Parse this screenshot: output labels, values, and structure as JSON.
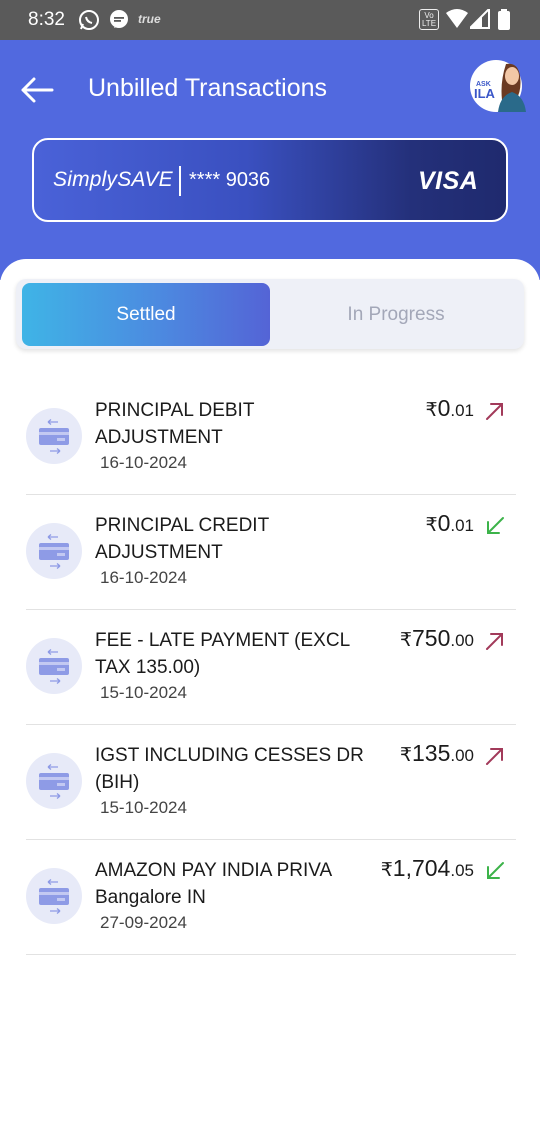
{
  "status_bar": {
    "time": "8:32",
    "carrier_tag": "true",
    "volte_label": "Vo LTE"
  },
  "header": {
    "title": "Unbilled Transactions",
    "assistant_label": "ASK ILA"
  },
  "card": {
    "brand": "SimplySAVE",
    "number": "**** 9036",
    "network": "VISA"
  },
  "tabs": [
    {
      "label": "Settled",
      "active": true
    },
    {
      "label": "In Progress",
      "active": false
    }
  ],
  "currency_symbol": "₹",
  "transactions": [
    {
      "name": "PRINCIPAL DEBIT ADJUSTMENT",
      "date": "16-10-2024",
      "amount_main": "0",
      "amount_dec": ".01",
      "direction": "debit"
    },
    {
      "name": "PRINCIPAL CREDIT ADJUSTMENT",
      "date": "16-10-2024",
      "amount_main": "0",
      "amount_dec": ".01",
      "direction": "credit"
    },
    {
      "name": "FEE - LATE PAYMENT (EXCL TAX 135.00)",
      "date": "15-10-2024",
      "amount_main": "750",
      "amount_dec": ".00",
      "direction": "debit"
    },
    {
      "name": "IGST INCLUDING CESSES DR (BIH)",
      "date": "15-10-2024",
      "amount_main": "135",
      "amount_dec": ".00",
      "direction": "debit"
    },
    {
      "name": "AMAZON PAY INDIA PRIVA Bangalore IN",
      "date": "27-09-2024",
      "amount_main": "1,704",
      "amount_dec": ".05",
      "direction": "credit"
    }
  ],
  "colors": {
    "header": "#5169df",
    "debit_arrow": "#a23a5a",
    "credit_arrow": "#3cb34a",
    "tab_active_start": "#3fb4e6",
    "tab_active_end": "#5464d6"
  }
}
